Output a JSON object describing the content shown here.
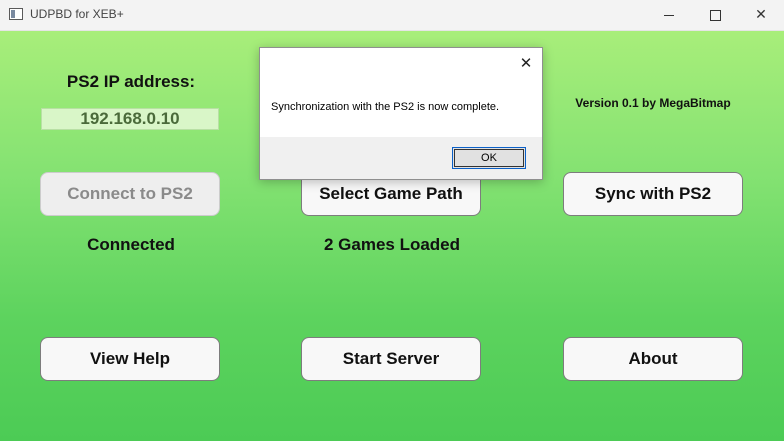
{
  "window": {
    "title": "UDPBD for XEB+",
    "icons": {
      "app": "window-app-icon",
      "minimize": "minimize-icon",
      "maximize": "maximize-icon",
      "close": "close-icon"
    }
  },
  "main": {
    "ip_label": "PS2 IP address:",
    "ip_value": "192.168.0.10",
    "version": "Version 0.1 by MegaBitmap",
    "buttons": {
      "connect": "Connect to PS2",
      "select_path": "Select Game Path",
      "sync": "Sync with PS2",
      "help": "View Help",
      "start_server": "Start Server",
      "about": "About"
    },
    "status": {
      "connection": "Connected",
      "games": "2 Games Loaded"
    },
    "colors": {
      "gradient_top": "#a8ee7a",
      "gradient_bottom": "#4ccb55"
    }
  },
  "dialog": {
    "message": "Synchronization with the PS2 is now complete.",
    "ok_label": "OK",
    "close_glyph": "✕"
  }
}
